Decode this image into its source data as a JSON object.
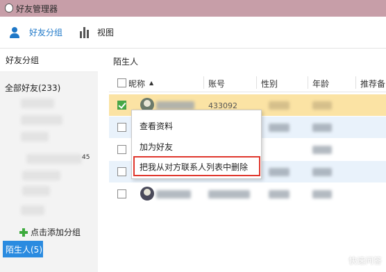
{
  "window": {
    "title": "好友管理器"
  },
  "toolbar": {
    "friend_group_label": "好友分组",
    "view_label": "视图"
  },
  "sidebar": {
    "heading": "好友分组",
    "all_friends": "全部好友(233)",
    "partial_count": "45",
    "add_group_label": "点击添加分组",
    "stranger_tab": "陌生人(5)"
  },
  "main": {
    "title": "陌生人",
    "columns": [
      "昵称",
      "账号",
      "性别",
      "年龄",
      "推荐备"
    ],
    "sort_indicator": "▲",
    "row_partial_text": "433092",
    "row_count": 5
  },
  "context_menu": {
    "items": [
      "查看资料",
      "加为好友",
      "把我从对方联系人列表中删除"
    ]
  },
  "watermark": {
    "text": "快速问答"
  },
  "colors": {
    "title_bar": "#c79ea8",
    "accent": "#1f78c8",
    "selected_row": "#fbe3a4",
    "highlight_border": "#e0362c",
    "tab_bg": "#2a8be0"
  }
}
